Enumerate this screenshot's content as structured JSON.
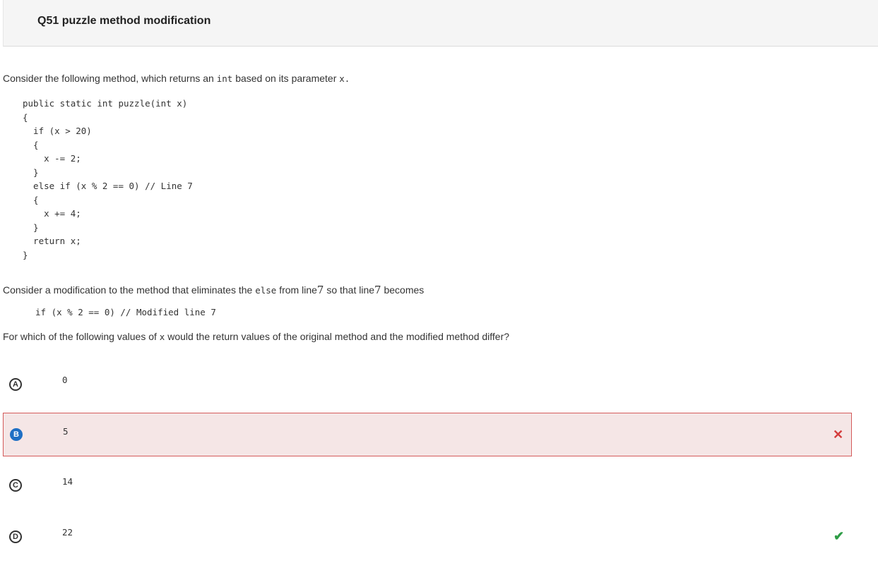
{
  "header": {
    "title": "Q51 puzzle method modification"
  },
  "question": {
    "intro_prefix": "Consider the following method, which returns an",
    "intro_code": "int",
    "intro_mid": "based on its parameter",
    "intro_param": "x.",
    "code_lines": [
      "public static int puzzle(int x)",
      "{",
      "  if (x > 20)",
      "  {",
      "    x -= 2;",
      "  }",
      "  else if (x % 2 == 0) // Line 7",
      "  {",
      "    x += 4;",
      "  }",
      "  return x;",
      "}"
    ],
    "mod_prefix": "Consider a modification to the method that eliminates the",
    "mod_code": "else",
    "mod_mid": "from line",
    "mod_line_num": "7",
    "mod_mid2": "so that line",
    "mod_line_num2": "7",
    "mod_suffix": "becomes",
    "modified_line": "if (x % 2 == 0) // Modified line 7",
    "prompt_prefix": "For which of the following values of",
    "prompt_code": "x",
    "prompt_suffix": "would the return values of the original method and the modified method differ?"
  },
  "choices": [
    {
      "letter": "A",
      "value": "0"
    },
    {
      "letter": "B",
      "value": "5",
      "status": "selected-incorrect"
    },
    {
      "letter": "C",
      "value": "14"
    },
    {
      "letter": "D",
      "value": "22",
      "status": "correct"
    }
  ],
  "marks": {
    "wrong_glyph": "✕",
    "right_glyph": "✔"
  },
  "colors": {
    "selected_bg": "#f5e6e6",
    "selected_border": "#d45a5a",
    "wrong_mark": "#d43c3c",
    "right_mark": "#2e9d46",
    "selected_badge": "#1e6fc4"
  }
}
